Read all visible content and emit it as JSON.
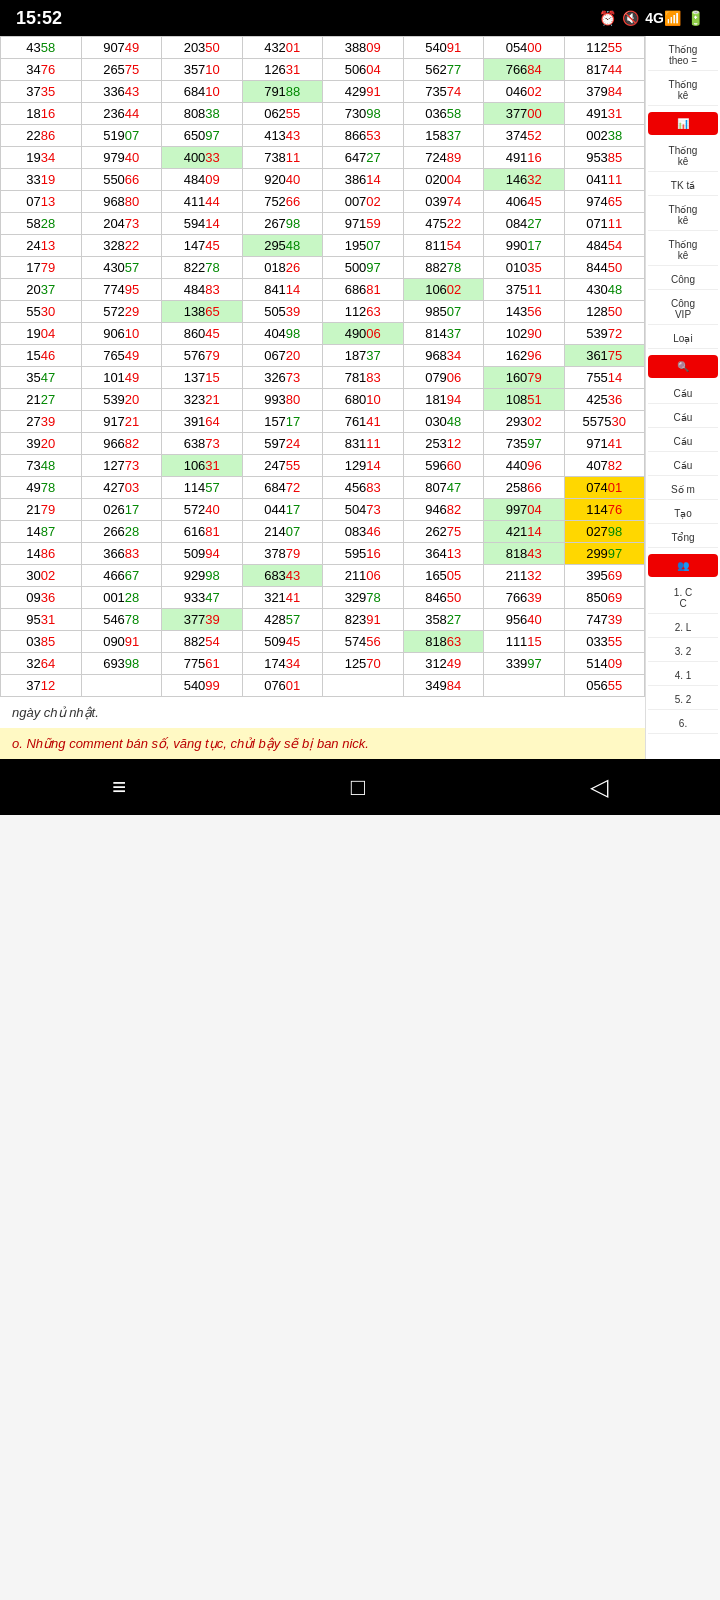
{
  "statusBar": {
    "time": "15:52",
    "icons": [
      "⏰",
      "🔇",
      "4G",
      "🔋"
    ]
  },
  "sidebar": {
    "items": [
      {
        "id": "thong-ke-theo",
        "label": "Thống\ntheo =",
        "type": "text"
      },
      {
        "id": "thong-ke",
        "label": "Thống\nkê",
        "type": "text"
      },
      {
        "id": "chart-btn",
        "label": "📊",
        "type": "btn-red"
      },
      {
        "id": "thong-ke2",
        "label": "Thống\nkê",
        "type": "text"
      },
      {
        "id": "tk-ta",
        "label": "TK tầ",
        "type": "text"
      },
      {
        "id": "thong-ke3",
        "label": "Thống\nkê",
        "type": "text"
      },
      {
        "id": "thong-ke4",
        "label": "Thống\nkê",
        "type": "text"
      },
      {
        "id": "cong1",
        "label": "Công",
        "type": "text"
      },
      {
        "id": "cong-vip",
        "label": "Công\nVIP",
        "type": "text"
      },
      {
        "id": "loai",
        "label": "Loại",
        "type": "text"
      },
      {
        "id": "search-btn",
        "label": "🔍",
        "type": "btn-red"
      },
      {
        "id": "cau1",
        "label": "Cầu",
        "type": "text"
      },
      {
        "id": "cau2",
        "label": "Cầu",
        "type": "text"
      },
      {
        "id": "cau3",
        "label": "Cầu",
        "type": "text"
      },
      {
        "id": "cau4",
        "label": "Cầu",
        "type": "text"
      },
      {
        "id": "so-m",
        "label": "Số m",
        "type": "text"
      },
      {
        "id": "tao",
        "label": "Tạo",
        "type": "text"
      },
      {
        "id": "tong",
        "label": "Tổng",
        "type": "text"
      },
      {
        "id": "group-btn",
        "label": "👥",
        "type": "btn-red"
      },
      {
        "id": "list1",
        "label": "1. C\nC",
        "type": "text"
      },
      {
        "id": "list2",
        "label": "2. L",
        "type": "text"
      },
      {
        "id": "list3",
        "label": "3. 2",
        "type": "text"
      },
      {
        "id": "list4",
        "label": "4. 1",
        "type": "text"
      },
      {
        "id": "list5",
        "label": "5. 2",
        "type": "text"
      },
      {
        "id": "list6",
        "label": "6.",
        "type": "text"
      }
    ]
  },
  "table": {
    "rows": [
      [
        "4358",
        "90749",
        "20350",
        "43201",
        "38809",
        "54091",
        "05400",
        "11255"
      ],
      [
        "3476",
        "26575",
        "35710",
        "12631",
        "50604",
        "56277",
        "76684",
        "81744"
      ],
      [
        "3735",
        "33643",
        "68410",
        "79188",
        "42991",
        "73574",
        "04602",
        "37984"
      ],
      [
        "1816",
        "23644",
        "80838",
        "06255",
        "73098",
        "03658",
        "37700",
        "49131"
      ],
      [
        "2286",
        "51907",
        "65097",
        "41343",
        "86653",
        "15837",
        "37452",
        "00238"
      ],
      [
        "1934",
        "97940",
        "40033",
        "73811",
        "64727",
        "72489",
        "49116",
        "95385"
      ],
      [
        "3319",
        "55066",
        "48409",
        "92040",
        "38614",
        "02004",
        "14632",
        "04111"
      ],
      [
        "0713",
        "96880",
        "41144",
        "75266",
        "00702",
        "03974",
        "40645",
        "97465"
      ],
      [
        "5828",
        "20473",
        "59414",
        "26798",
        "97159",
        "47522",
        "08427",
        "07111"
      ],
      [
        "2413",
        "32822",
        "14745",
        "29548",
        "19507",
        "81154",
        "99017",
        "48454"
      ],
      [
        "1779",
        "43057",
        "82278",
        "01826",
        "50097",
        "88278",
        "01035",
        "84450"
      ],
      [
        "2037",
        "77495",
        "48483",
        "84114",
        "68681",
        "10602",
        "37511",
        "43048"
      ],
      [
        "5530",
        "57229",
        "13865",
        "50539",
        "11263",
        "98507",
        "14356",
        "12850"
      ],
      [
        "1904",
        "90610",
        "86045",
        "40498",
        "49006",
        "81437",
        "10290",
        "53972"
      ],
      [
        "1546",
        "76549",
        "57679",
        "06720",
        "18737",
        "96834",
        "16296",
        "36175"
      ],
      [
        "3547",
        "10149",
        "13715",
        "32673",
        "78183",
        "07906",
        "16079",
        "75514"
      ],
      [
        "2127",
        "53920",
        "32321",
        "99380",
        "68010",
        "18194",
        "10851",
        "42536"
      ],
      [
        "2739",
        "91721",
        "39164",
        "15717",
        "76141",
        "03048",
        "29302",
        "557530"
      ],
      [
        "3920",
        "96682",
        "63873",
        "59724",
        "83111",
        "25312",
        "73597",
        "97141"
      ],
      [
        "7348",
        "12773",
        "10631",
        "24755",
        "12914",
        "59660",
        "44096",
        "40782"
      ],
      [
        "4978",
        "42703",
        "11457",
        "68472",
        "45683",
        "80747",
        "25866",
        "07401"
      ],
      [
        "2179",
        "02617",
        "57240",
        "04417",
        "50473",
        "94682",
        "99704",
        "11476"
      ],
      [
        "1487",
        "26628",
        "61681",
        "21407",
        "08346",
        "26275",
        "42114",
        "02798"
      ],
      [
        "1486",
        "36683",
        "50994",
        "37879",
        "59516",
        "36413",
        "81843",
        "29997"
      ],
      [
        "3002",
        "46667",
        "92998",
        "68343",
        "21106",
        "16505",
        "21132",
        "39569"
      ],
      [
        "0936",
        "00128",
        "93347",
        "32141",
        "32978",
        "84650",
        "76639",
        "85069"
      ],
      [
        "9531",
        "54678",
        "37739",
        "42857",
        "82391",
        "35827",
        "95640",
        "74739"
      ],
      [
        "0385",
        "09091",
        "88254",
        "50945",
        "57456",
        "81863",
        "11115",
        "03355"
      ],
      [
        "3264",
        "69398",
        "77561",
        "17434",
        "12570",
        "31249",
        "33997",
        "51409"
      ],
      [
        "3712",
        "",
        "54099",
        "07601",
        "",
        "34984",
        "",
        "05655"
      ]
    ],
    "highlights": {
      "green": [
        [
          1,
          6
        ],
        [
          2,
          3
        ],
        [
          3,
          6
        ],
        [
          5,
          2
        ],
        [
          6,
          6
        ],
        [
          9,
          3
        ],
        [
          11,
          5
        ],
        [
          12,
          2
        ],
        [
          13,
          4
        ],
        [
          14,
          7
        ],
        [
          15,
          6
        ],
        [
          16,
          6
        ],
        [
          19,
          2
        ],
        [
          21,
          6
        ],
        [
          22,
          6
        ],
        [
          23,
          6
        ],
        [
          24,
          3
        ],
        [
          26,
          2
        ],
        [
          27,
          5
        ]
      ],
      "yellow": [
        [
          20,
          7
        ],
        [
          21,
          7
        ],
        [
          22,
          7
        ],
        [
          23,
          7
        ]
      ]
    }
  },
  "footer": {
    "note1": "ngày chủ nhật.",
    "note2": "o. Những comment bán số, văng tục, chửi bậy sẽ bị ban nick."
  },
  "nav": {
    "menu_icon": "≡",
    "home_icon": "□",
    "back_icon": "◁"
  }
}
